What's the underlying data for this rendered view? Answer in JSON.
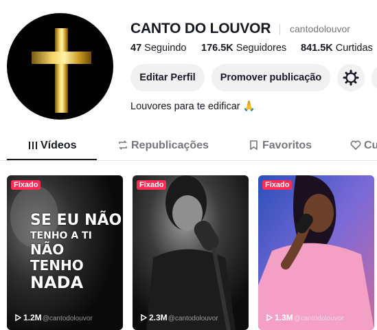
{
  "profile": {
    "display_name": "CANTO DO LOUVOR",
    "username": "cantodolouvor",
    "bio": "Louvores para te edificar 🙏",
    "stats": {
      "following_count": "47",
      "following_label": "Seguindo",
      "followers_count": "176.5K",
      "followers_label": "Seguidores",
      "likes_count": "841.5K",
      "likes_label": "Curtidas"
    }
  },
  "actions": {
    "edit_profile": "Editar Perfil",
    "promote": "Promover publicação"
  },
  "icons": {
    "settings": "gear-icon",
    "videos": "grid-bars-icon",
    "reposts": "repost-icon",
    "favorites": "bookmark-icon",
    "liked": "heart-icon",
    "play": "play-icon"
  },
  "tabs": [
    {
      "label": "Vídeos"
    },
    {
      "label": "Republicações"
    },
    {
      "label": "Favoritos"
    },
    {
      "label": "Cu"
    }
  ],
  "videos": [
    {
      "badge": "Fixado",
      "views": "1.2M",
      "watermark": "@cantodolouvor",
      "overlay_lines": [
        "SE EU NÃO",
        "TENHO A TI",
        "NÃO",
        "TENHO",
        "NADA"
      ]
    },
    {
      "badge": "Fixado",
      "views": "2.3M",
      "watermark": "@cantodolouvor"
    },
    {
      "badge": "Fixado",
      "views": "1.3M",
      "watermark": "@cantodolouvor"
    }
  ],
  "colors": {
    "accent": "#fe2c55",
    "text": "#161823",
    "muted": "#75767c",
    "button_bg": "#f1f1f2"
  }
}
